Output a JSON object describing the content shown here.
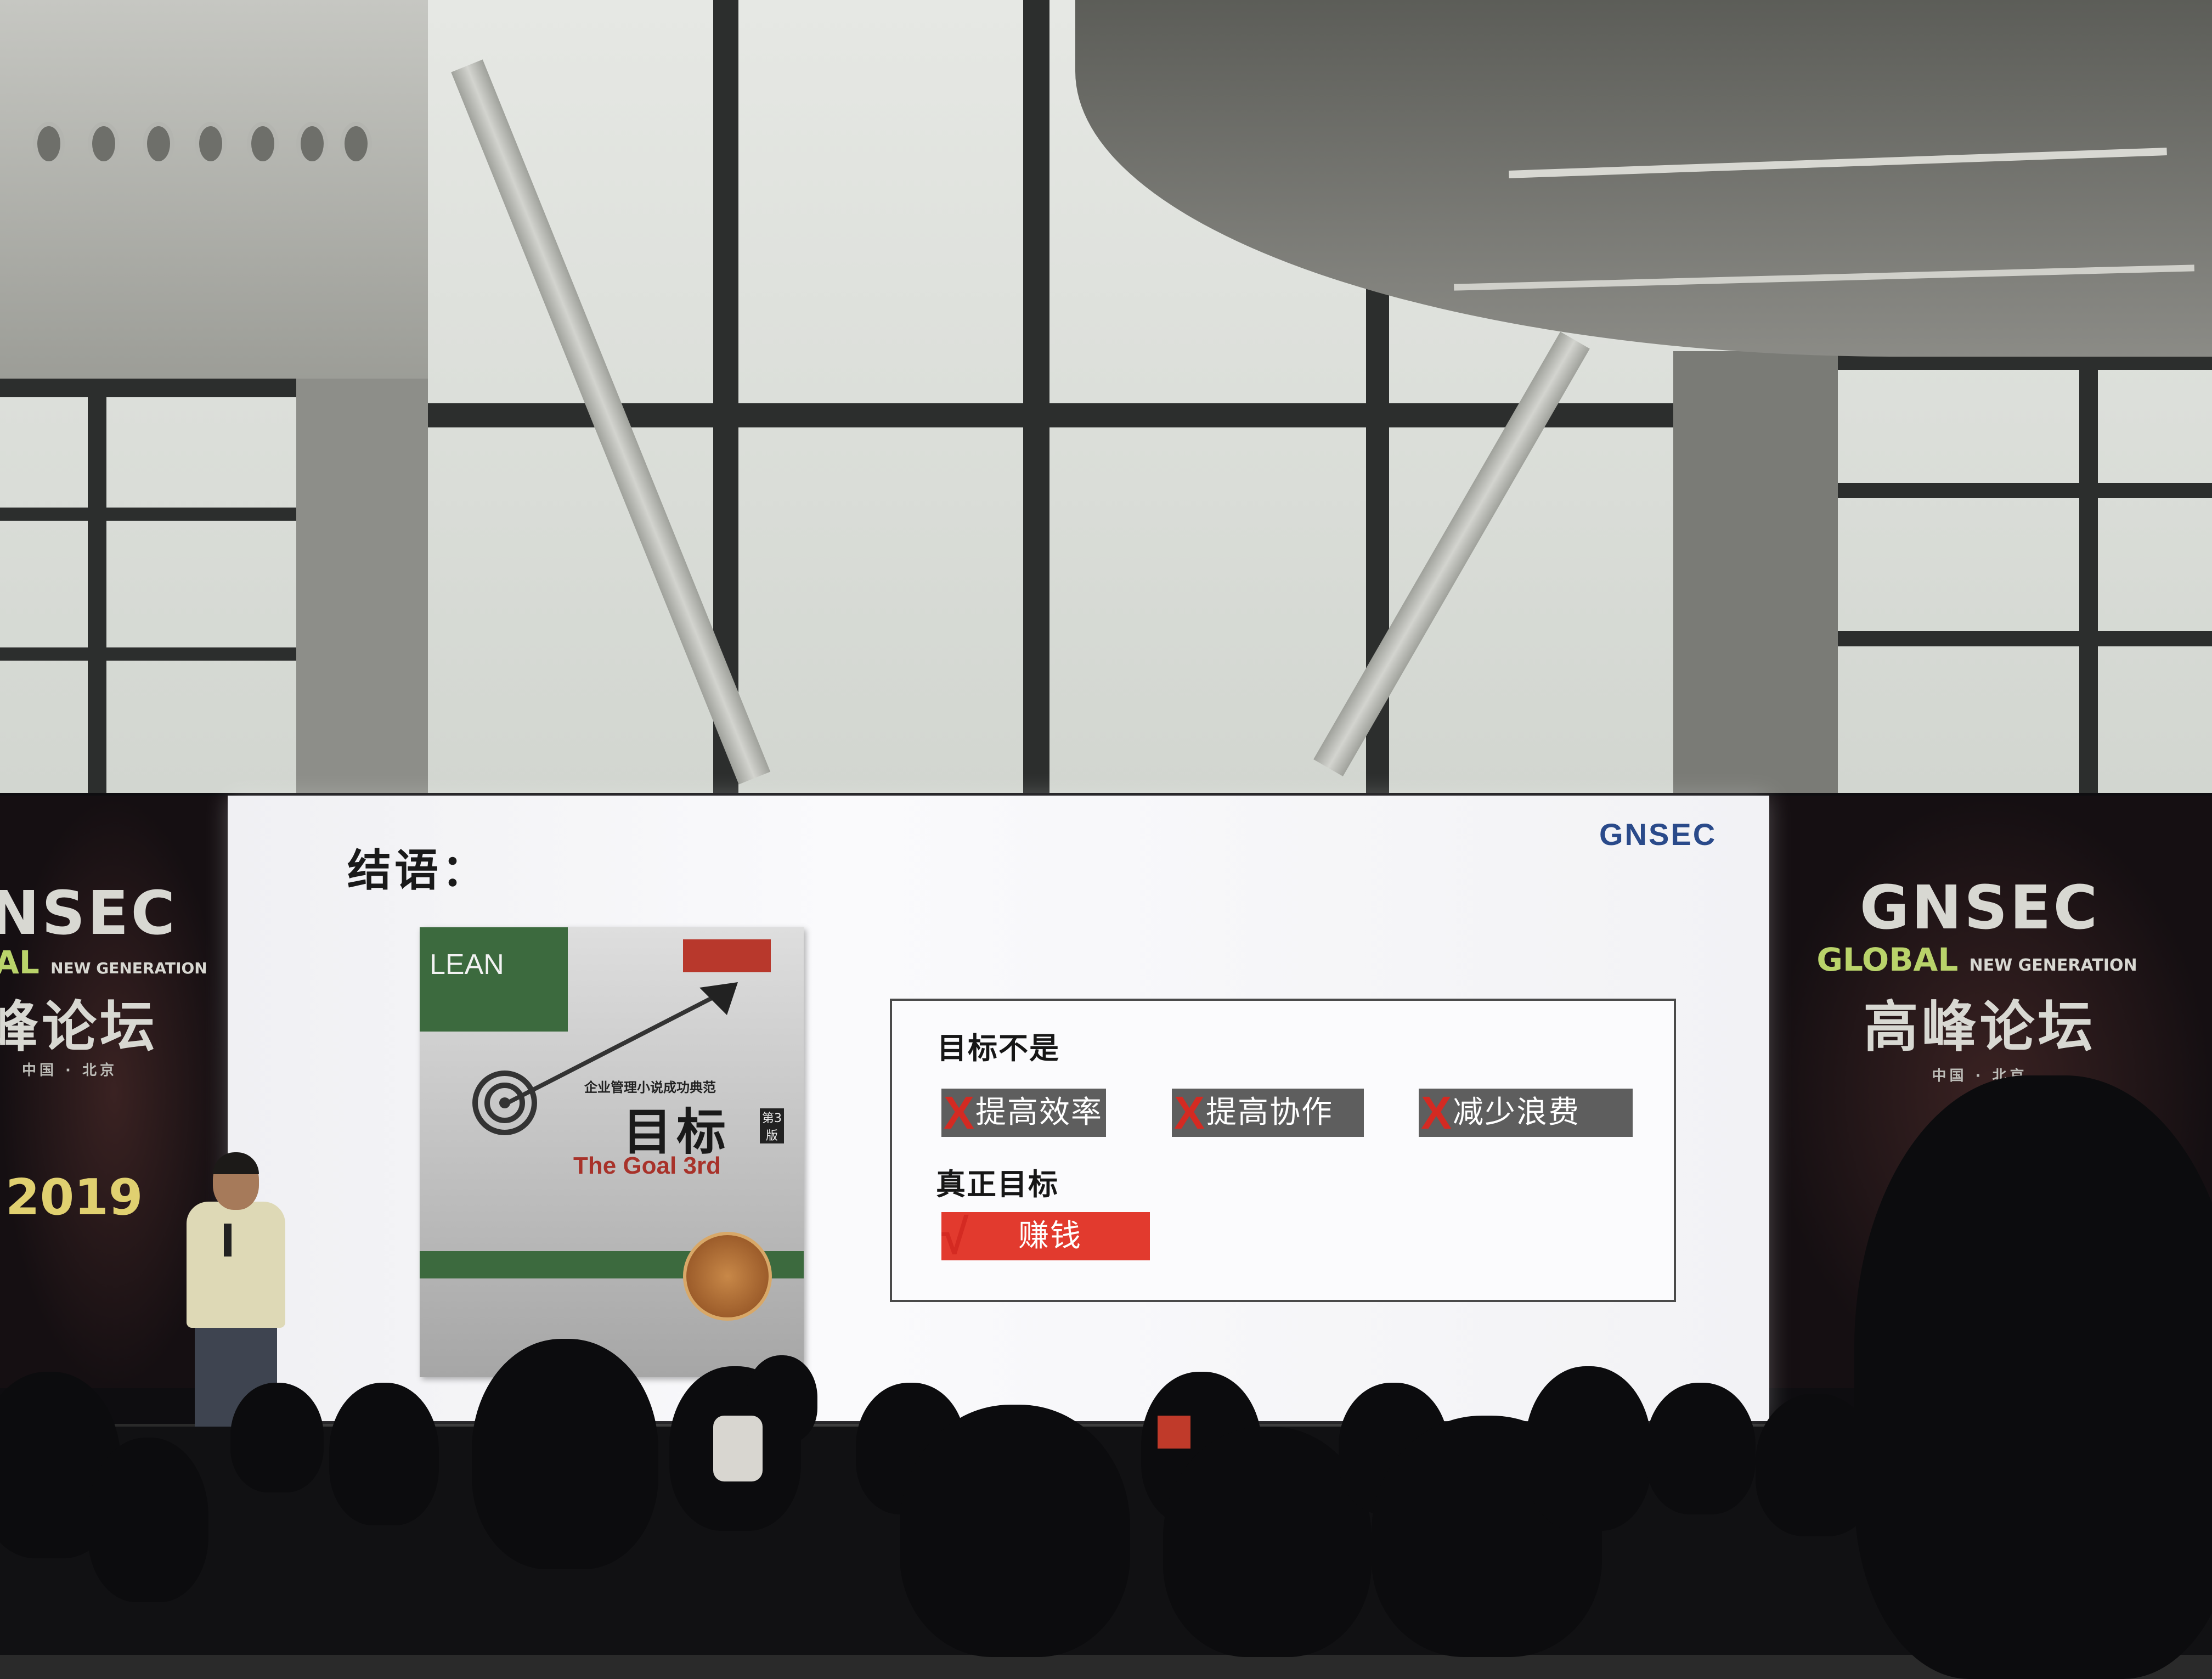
{
  "stage_banners": {
    "left": {
      "gnsec": "NSEC",
      "global_prefix": "AL",
      "global_suffix": "NEW GENERATION",
      "forum": "峰论坛",
      "location": "中国 · 北京",
      "year": "2019"
    },
    "right": {
      "gnsec": "GNSEC",
      "global_prefix": "GLOBAL",
      "global_suffix": "NEW GENERATION",
      "forum": "高峰论坛",
      "location": "中国 · 北京"
    }
  },
  "slide": {
    "logo": "GNSEC",
    "title": "结语：",
    "book": {
      "lean_label": "LEAN",
      "subtitle": "企业管理小说成功典范",
      "title": "目标",
      "edition": "第3版",
      "english_title": "The Goal 3rd"
    },
    "not_goal_heading": "目标不是",
    "not_goals": [
      {
        "mark": "X",
        "text": "提高效率"
      },
      {
        "mark": "X",
        "text": "提高协作"
      },
      {
        "mark": "X",
        "text": "减少浪费"
      }
    ],
    "real_goal_heading": "真正目标",
    "real_goal": {
      "mark": "√",
      "text": "赚钱"
    },
    "colors": {
      "cross": "#d42a22",
      "tag_gray": "#5e5e5e",
      "tag_red": "#e23a2e",
      "logo_blue": "#2a4a8a"
    }
  }
}
